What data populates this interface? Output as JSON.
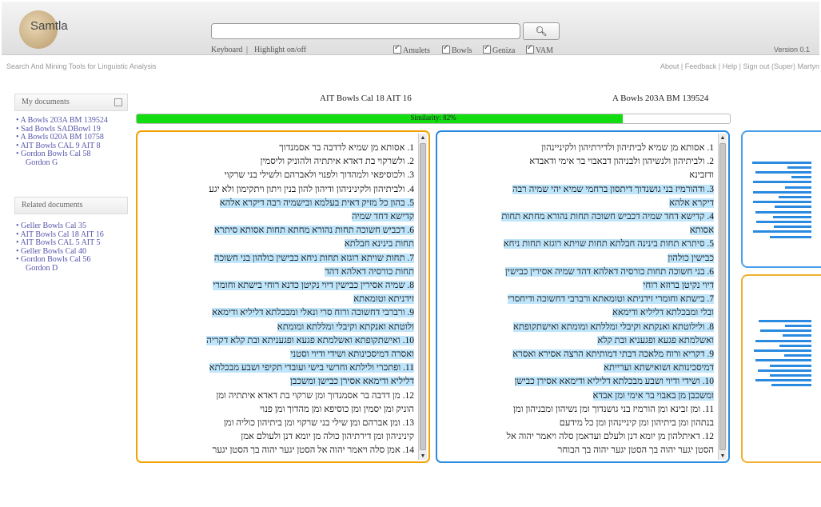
{
  "header": {
    "logo_text": "Samtla",
    "search_placeholder": "",
    "search_icon": "magnifier-icon",
    "keyboard_label": "Keyboard",
    "highlight_label": "Highlight on/off",
    "filters": [
      "Amulets",
      "Bowls",
      "Geniza",
      "VAM"
    ],
    "version": "Version 0.1",
    "tagline": "Search And Mining Tools for Linguistic Analysis",
    "top_links": "About | Feedback | Help | Sign out (Super) Martyn"
  },
  "sidebar": {
    "my_documents_title": "My documents",
    "my_documents": [
      "A Bowls 203A BM 139524",
      "Sad Bowls SADBowl 19",
      "A Bowls 020A BM 10758",
      "AIT Bowls CAL 9 AIT 8",
      "Gordon Bowls Cal 58",
      "Gordon G"
    ],
    "related_title": "Related documents",
    "related": [
      "Geller Bowls Cal 35",
      "AIT Bowls Cal 18 AIT 16",
      "AIT Bowls CAL 5 AIT 5",
      "Geller Bowls Cal 40",
      "Gordon Bowls Cal 56",
      "Gordon D"
    ]
  },
  "compare": {
    "left_title": "AIT Bowls Cal 18 AIT 16",
    "right_title": "A Bowls 203A BM 139524",
    "similarity_label": "Similarity: 82%",
    "similarity": 0.82
  },
  "left_text": [
    {
      "text": "1. אסותא מן שמיא לדדבה בר אסמנדוך",
      "hl": false
    },
    {
      "text": "2. ולשרקוי בת דאדא איתתיה ולהוניק וליסמין",
      "hl": false
    },
    {
      "text": "3. ולכוסיפאי ולמהדוך ולפנוי ולאברהם ולשילי בני שרקוי",
      "hl": false
    },
    {
      "text": "4. ולביתיהון ולקיניניהון ודיהון להון בנין ויתון ויתקימון ולא יגע",
      "hl": false
    },
    {
      "text": "5. בהון כל מזיק דאית בעלמא ובישמיה רבה דיקרא אלהא",
      "hl": true
    },
    {
      "text": "קדישא דחד שמיה",
      "hl": true
    },
    {
      "text": "6. דכביש חשוכה תחות נהורא מחתא תחות אסותא סיתרא",
      "hl": true
    },
    {
      "text": "תחות בינינא חבלתא",
      "hl": true
    },
    {
      "text": "7. תחות שויתא רוגזא תחות ניחא כבישין כולהון בני חשוכה",
      "hl": true
    },
    {
      "text": "תחות כורסיה דאלהא דהד",
      "hl": true
    },
    {
      "text": "8. שמיה אסירין כבישין דיוי נקיטן כדנא רוחי בישתא וחומרי",
      "hl": true
    },
    {
      "text": "זידניתא וטומאתא",
      "hl": true
    },
    {
      "text": "9. ורברבי דחשוכה ורוח סרי ונאלי ומבכלתא דליליא ודימאא",
      "hl": true
    },
    {
      "text": "ולוטתא ואנקתא וקיבלי ומללתא ומומתא",
      "hl": true
    },
    {
      "text": "10. ואישתקופתא ואשלמתא פגעא ופגעניתא ובת קלא דקריה",
      "hl": true
    },
    {
      "text": "ואסרה דמיסכינותא ושידי ודיוי וסטני",
      "hl": true
    },
    {
      "text": "11. ופתכרי ולילתא וחרשי בישי ועובדי תקיפי ושבע מבכלתא",
      "hl": true
    },
    {
      "text": "דליליא ודימאא אסירן כבישן ומשכבן",
      "hl": true
    },
    {
      "text": "12. מן דדבה בר אסמנדוך ומן שרקוי בת דאדא איתתיה ומן",
      "hl": false
    },
    {
      "text": "הוניק ומן יסמין ומן כוסיפא ומן מהדוך ומן פנוי",
      "hl": false
    },
    {
      "text": "13. ומן אברהם ומן שילי בני שרקוי ומן ביתיהון כוליה ומן",
      "hl": false
    },
    {
      "text": "קיניניהון ומן דירתיהון כולה מן יומא דנן ולעולם אמן",
      "hl": false
    },
    {
      "text": "14. אמן סלה ויאמר יהוה אל הסטן יגער יהוה בך הסטן יגער",
      "hl": false
    }
  ],
  "right_text": [
    {
      "text": "1. אסותא מן שמיא לביתיהון ולדירתיהון ולקיניינהון",
      "hl": false
    },
    {
      "text": "2. ולביתיהון ולנשיהון ולבניהון דבאבוי בר אימי ודאבדא",
      "hl": false
    },
    {
      "text": "ודזבינא",
      "hl": false
    },
    {
      "text": "3. ודהורמיז בני גושנדוך דיתסון ברחמי שמיא יהי שמיה רבה",
      "hl": true
    },
    {
      "text": "דיקרא אלהא",
      "hl": true
    },
    {
      "text": "4. קדישא דחד שמיה דכביש חשוכה תחות נהורא מחתא תחות",
      "hl": true
    },
    {
      "text": "אסותא",
      "hl": true
    },
    {
      "text": "5. סיתרא תחות בינינה חבלתא תחות שויתא רוגזא תחות ניחא",
      "hl": true
    },
    {
      "text": "כבישין כולהון",
      "hl": true
    },
    {
      "text": "6. בני חשוכה תחות כורסיה דאלהא דהד שמיה אסירין כבישין",
      "hl": true
    },
    {
      "text": "דיוי נקיטן ברוזא רוחי",
      "hl": true
    },
    {
      "text": "7. בישתא וחומרי זידניתא וטומאתא ורברבי דחשוכה ודיחסרי",
      "hl": true
    },
    {
      "text": "ובלי ומבכלתא דליליא ודימאא",
      "hl": true
    },
    {
      "text": "8. ולילוטתא ואנקתא וקיבלי ומללתא ומומתא ואישתקופתא",
      "hl": true
    },
    {
      "text": "ואשלמתא פגעא ופגעניא ובת קלא",
      "hl": true
    },
    {
      "text": "9. דקריא ורוח מלאכה דבתי דמותיתא הרצה אסירא ואסרא",
      "hl": true
    },
    {
      "text": "דמיסכינותא ושואישתא וערייתא",
      "hl": true
    },
    {
      "text": "10. ושידי ודיוי ושבע מבכלתא דליליא ודימאא אסירן כבישן",
      "hl": true
    },
    {
      "text": "ומשכבן מן באבוי בר אימי ומן אבדא",
      "hl": true
    },
    {
      "text": "11. ומן זבינא ומן הורמיז בני גושנדוך ומן נשיהון ומבניהון ומן",
      "hl": false
    },
    {
      "text": "בנתהון ומן ביתיהון ומן קיניינהון ומן כל מידעם",
      "hl": false
    },
    {
      "text": "12. דאיתלהון מן יומא דנן ולעלם ועדאמן סלה ויאמר יהוה אל",
      "hl": false
    },
    {
      "text": "הסטן יגער יהוה בך הסטן יגער יהוה בך הבוחר",
      "hl": false
    }
  ],
  "icons": {
    "search": "magnifier-icon",
    "collapse": "collapse-icon",
    "scroll_up": "scroll-up-arrow-icon",
    "scroll_down": "scroll-down-arrow-icon"
  },
  "colors": {
    "left_pane_border": "#f0a200",
    "right_pane_border": "#2a8ae0",
    "highlight": "#bfe5fb",
    "similarity_fill": "#11dd11",
    "links": "#55a"
  }
}
